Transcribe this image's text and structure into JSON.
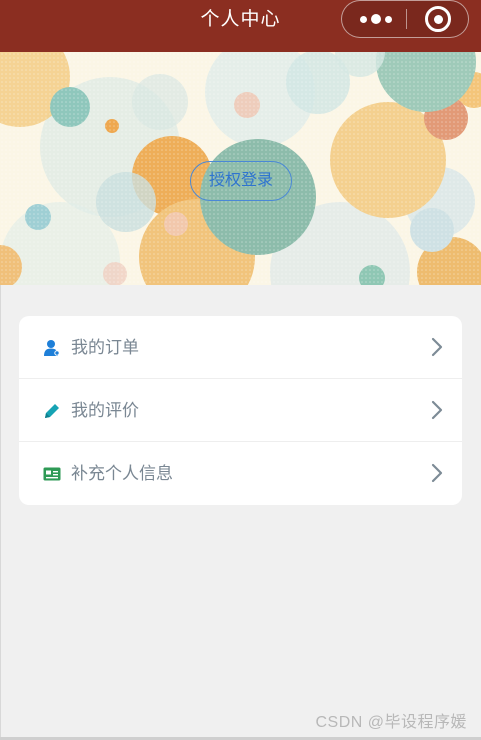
{
  "navbar": {
    "title": "个人中心",
    "capsule": {
      "more_icon": "more-dots-icon",
      "close_icon": "target-circle-icon"
    }
  },
  "banner": {
    "login_label": "授权登录"
  },
  "menu": {
    "items": [
      {
        "label": "我的订单",
        "icon": "user-icon",
        "icon_color": "#1e7fd8"
      },
      {
        "label": "我的评价",
        "icon": "pencil-icon",
        "icon_color": "#16a3b4"
      },
      {
        "label": "补充个人信息",
        "icon": "id-card-icon",
        "icon_color": "#2e9a55"
      }
    ]
  },
  "footer": {
    "watermark": "CSDN @毕设程序媛"
  },
  "colors": {
    "navbar_bg": "#8b2e21",
    "page_bg": "#f0f0f0",
    "label_text": "#7a8793",
    "login_border": "#4a88d6"
  }
}
